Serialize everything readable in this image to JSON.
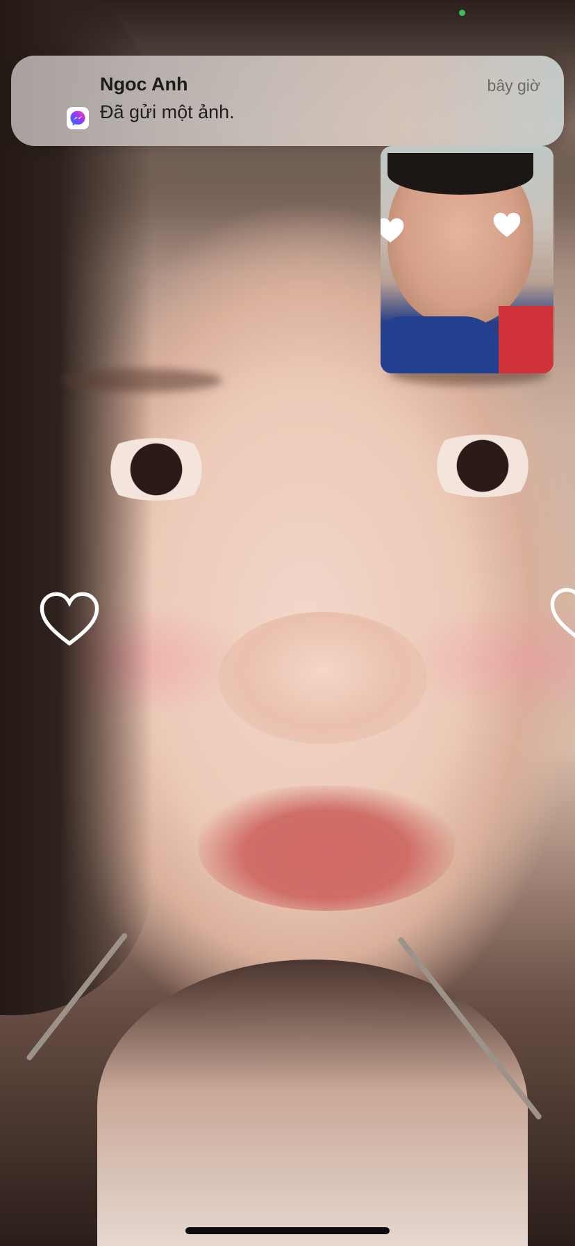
{
  "notification": {
    "app_icon": "messenger-icon",
    "sender": "Ngoc Anh",
    "message": "Đã gửi một ảnh.",
    "time": "bây giờ"
  },
  "call": {
    "remote_video": "remote-participant-video",
    "self_view": "self-camera-preview",
    "effect": "heart-filter"
  },
  "status": {
    "mic_indicator_color": "#36c15a"
  },
  "colors": {
    "messenger_gradient_start": "#0a7cff",
    "messenger_gradient_end": "#ff5280"
  }
}
